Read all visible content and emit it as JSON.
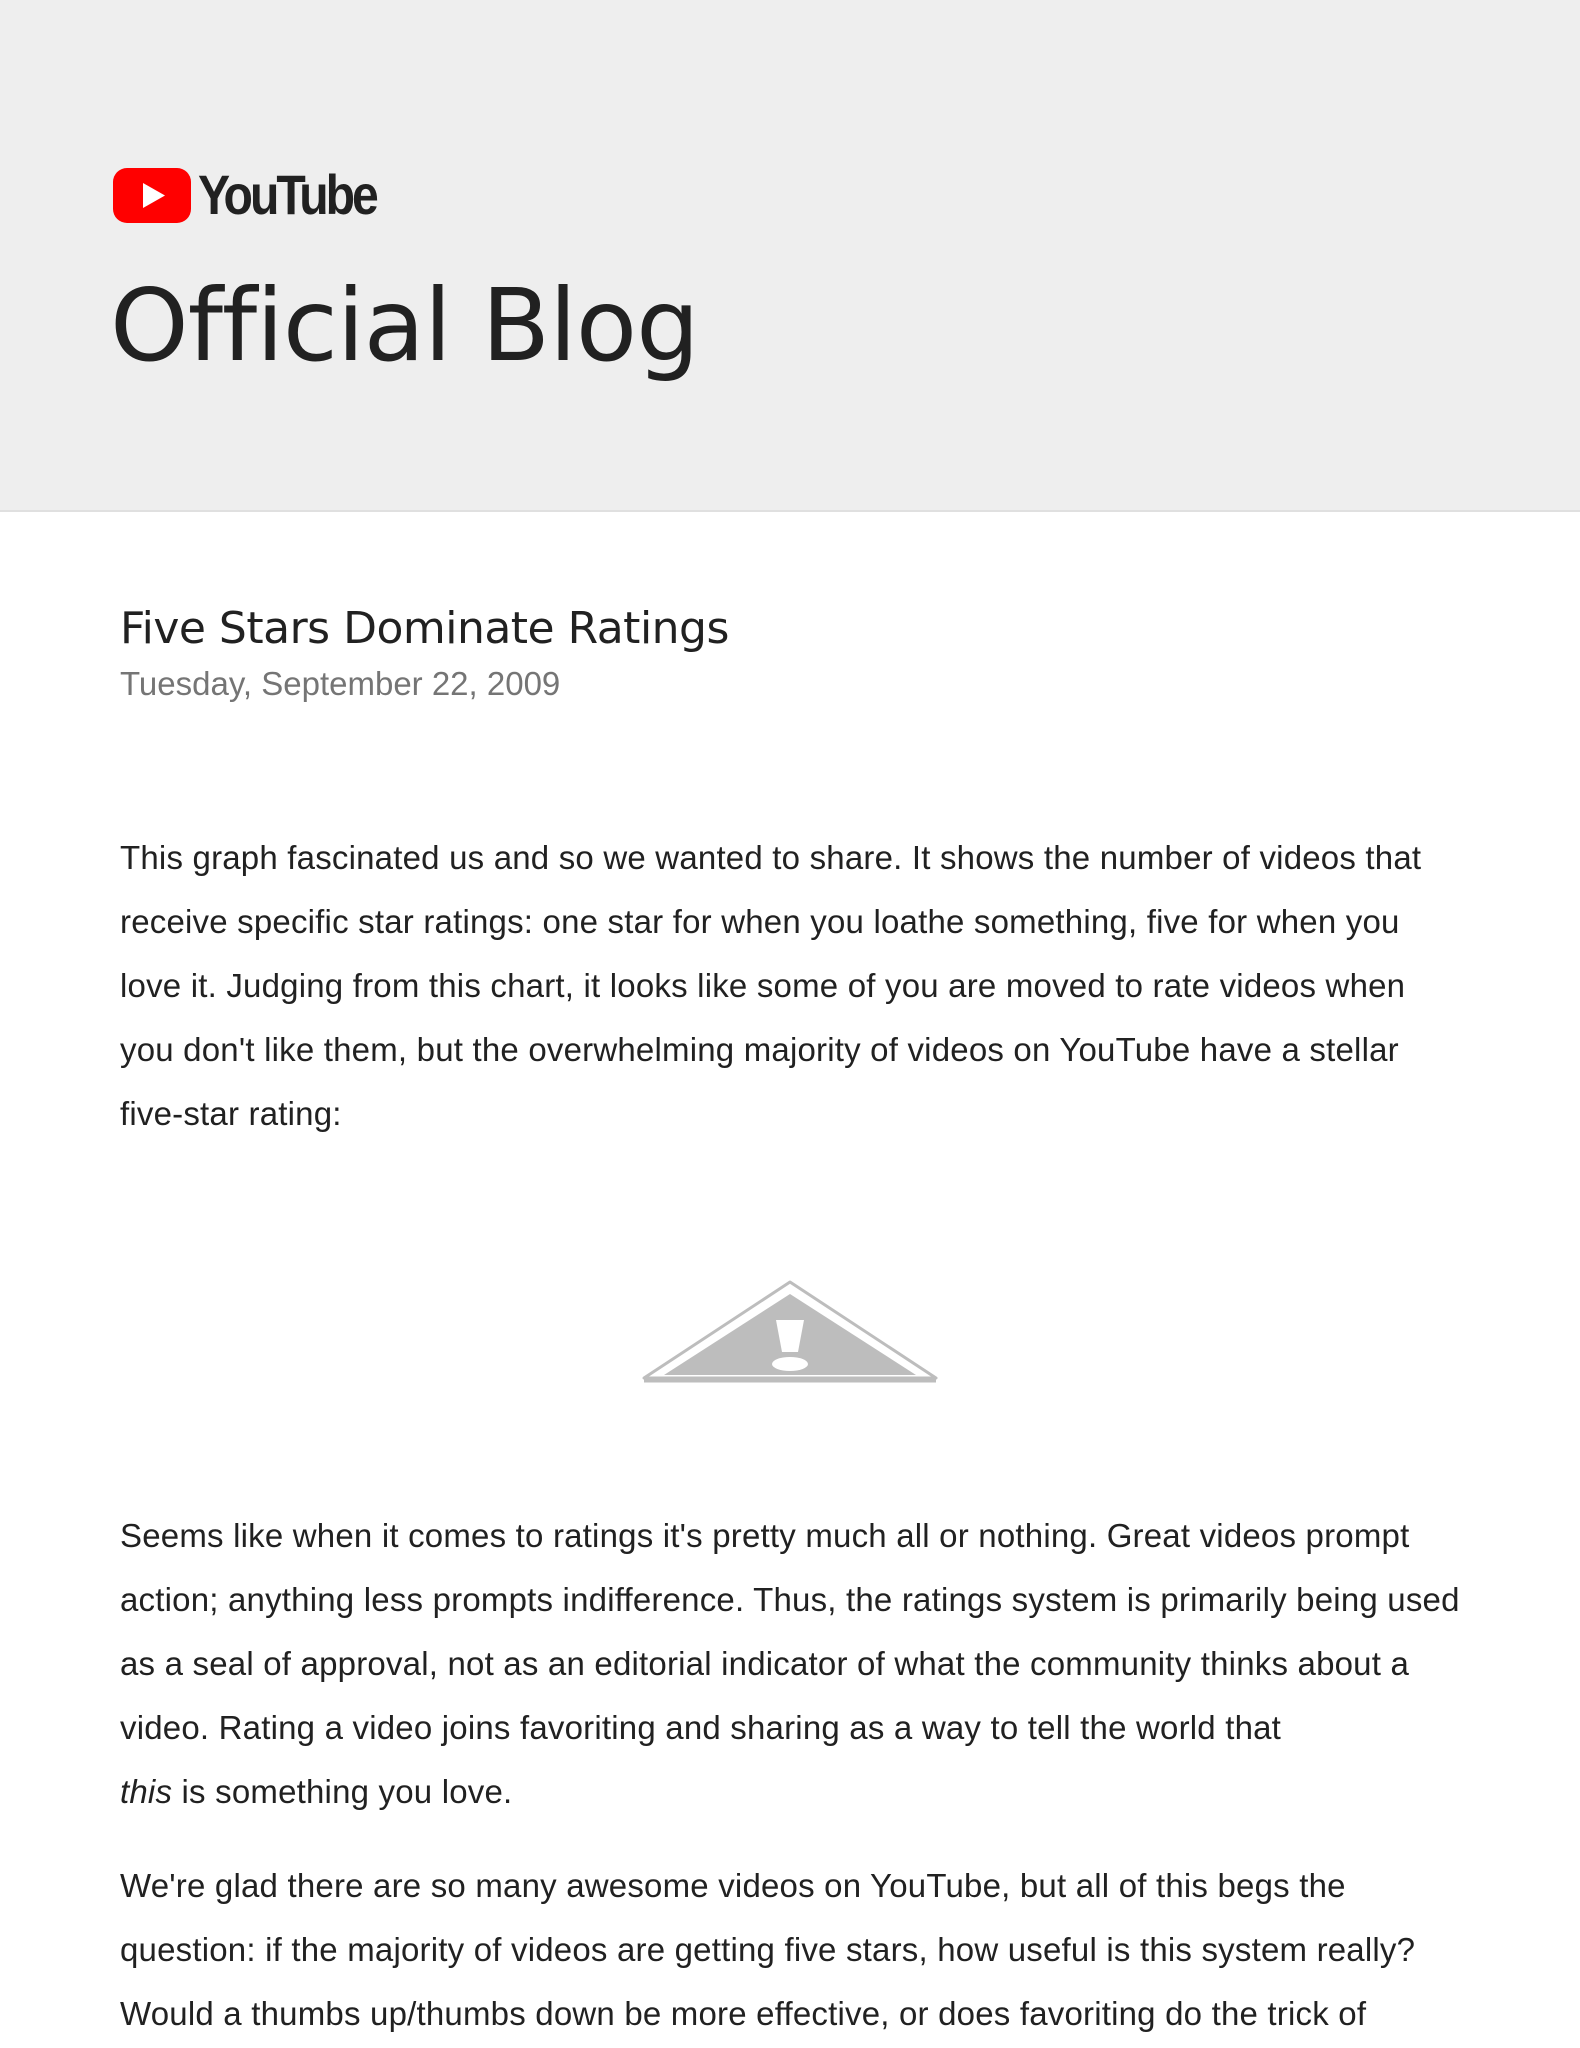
{
  "header": {
    "logo_text": "YouTube",
    "blog_title": "Official Blog",
    "brand_color": "#ff0000",
    "background_color": "#eeeeee"
  },
  "post": {
    "title": "Five Stars Dominate Ratings",
    "date": "Tuesday, September 22, 2009",
    "paragraph_1": "This graph fascinated us and so we wanted to share. It shows the number of videos that receive specific star ratings: one star for when you loathe something, five for when you love it. Judging from this chart, it looks like some of you are moved to rate videos when you don't like them, but the overwhelming majority of videos on YouTube have a stellar five-star rating:",
    "broken_image_icon": "broken-image-warning-icon",
    "paragraph_2_emphasis": "",
    "paragraph_2": "Seems like when it comes to ratings it's pretty much all or nothing. Great videos prompt action; anything less prompts indifference. Thus, the ratings system is primarily being used as a seal of approval, not as an editorial indicator of what the community thinks about a video. Rating a video joins favoriting and sharing as a way to tell the world that",
    "paragraph_2_italic": "this",
    "paragraph_2_tail": " is something you love.",
    "paragraph_3": "We're glad there are so many awesome videos on YouTube, but all of this begs the question: if the majority of videos are getting five stars, how useful is this system really? Would a thumbs up/thumbs down be more effective, or does favoriting do the trick of"
  }
}
